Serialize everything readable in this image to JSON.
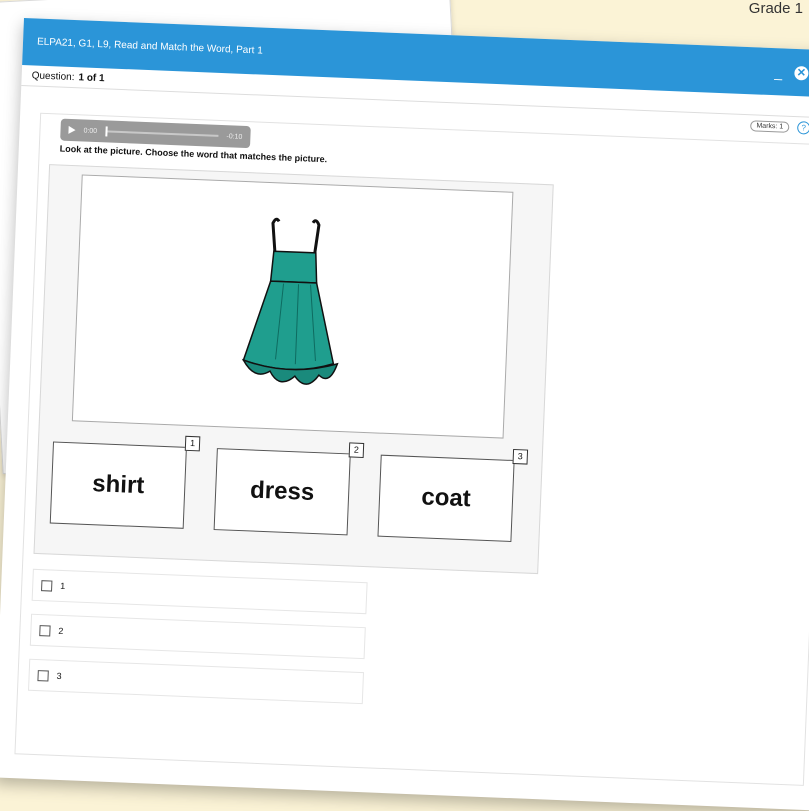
{
  "header": {
    "grade": "Grade 1"
  },
  "window": {
    "title": "ELPA21, G1, L9, Read and Match the Word, Part 1",
    "minimize_label": "_",
    "close_label": "✕"
  },
  "question": {
    "label": "Question:",
    "index": "1 of 1"
  },
  "tools": {
    "marks": "Marks: 1",
    "help_label": "?"
  },
  "audio": {
    "current_time": "0:00",
    "remaining_time": "-0:10",
    "progress": 0
  },
  "prompt": "Look at the picture. Choose the word that matches the picture.",
  "picture": {
    "icon": "dress-image"
  },
  "options": [
    {
      "word": "shirt",
      "number": "1"
    },
    {
      "word": "dress",
      "number": "2"
    },
    {
      "word": "coat",
      "number": "3"
    }
  ],
  "choices": [
    {
      "label": "1",
      "checked": false
    },
    {
      "label": "2",
      "checked": false
    },
    {
      "label": "3",
      "checked": false
    }
  ],
  "colors": {
    "accent": "#2b95d8",
    "dress": "#1f9e8e"
  }
}
